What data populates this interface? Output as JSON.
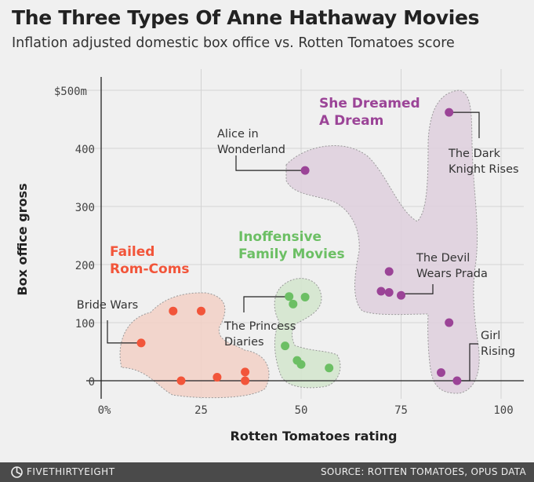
{
  "header": {
    "title": "The Three Types Of Anne Hathaway Movies",
    "subtitle": "Inflation adjusted domestic box office vs. Rotten Tomatoes score"
  },
  "footer": {
    "brand": "FIVETHIRTYEIGHT",
    "brand_icon": "fivethirtyeight-logo-icon",
    "source": "SOURCE: ROTTEN TOMATOES, OPUS DATA"
  },
  "chart_data": {
    "type": "scatter",
    "xlabel": "Rotten Tomatoes rating",
    "ylabel": "Box office gross",
    "xlim": [
      0,
      100
    ],
    "ylim": [
      0,
      500
    ],
    "x_ticks": [
      {
        "value": 0,
        "label": "0%"
      },
      {
        "value": 25,
        "label": "25"
      },
      {
        "value": 50,
        "label": "50"
      },
      {
        "value": 75,
        "label": "75"
      },
      {
        "value": 100,
        "label": "100"
      }
    ],
    "y_ticks": [
      {
        "value": 0,
        "label": "0"
      },
      {
        "value": 100,
        "label": "100"
      },
      {
        "value": 200,
        "label": "200"
      },
      {
        "value": 300,
        "label": "300"
      },
      {
        "value": 400,
        "label": "400"
      },
      {
        "value": 500,
        "label": "$500m"
      }
    ],
    "grid": true,
    "series": [
      {
        "name": "Failed Rom-Coms",
        "color": "#f2553a",
        "fill": "#f2d0c5",
        "points": [
          [
            10,
            65
          ],
          [
            18,
            120
          ],
          [
            25,
            120
          ],
          [
            20,
            0
          ],
          [
            29,
            6
          ],
          [
            36,
            15
          ],
          [
            36,
            0
          ]
        ]
      },
      {
        "name": "Inoffensive Family Movies",
        "color": "#6cbf64",
        "fill": "#d2e5cd",
        "points": [
          [
            47,
            145
          ],
          [
            48,
            132
          ],
          [
            51,
            144
          ],
          [
            46,
            60
          ],
          [
            49,
            35
          ],
          [
            50,
            28
          ],
          [
            57,
            22
          ]
        ]
      },
      {
        "name": "She Dreamed A Dream",
        "color": "#9b4497",
        "fill": "#decfdd",
        "points": [
          [
            51,
            362
          ],
          [
            72,
            188
          ],
          [
            70,
            154
          ],
          [
            72,
            152
          ],
          [
            75,
            147
          ],
          [
            87,
            462
          ],
          [
            87,
            100
          ],
          [
            85,
            14
          ],
          [
            89,
            0
          ]
        ]
      }
    ],
    "annotations": [
      {
        "text": "Bride Wars",
        "lines": [
          "Bride Wars"
        ]
      },
      {
        "text": "The Princess Diaries",
        "lines": [
          "The Princess",
          "Diaries"
        ]
      },
      {
        "text": "Alice in Wonderland",
        "lines": [
          "Alice in",
          "Wonderland"
        ]
      },
      {
        "text": "The Devil Wears Prada",
        "lines": [
          "The Devil",
          "Wears Prada"
        ]
      },
      {
        "text": "The Dark Knight Rises",
        "lines": [
          "The Dark",
          "Knight Rises"
        ]
      },
      {
        "text": "Girl Rising",
        "lines": [
          "Girl",
          "Rising"
        ]
      }
    ],
    "group_labels": [
      {
        "lines": [
          "Failed",
          "Rom-Coms"
        ],
        "color": "#f2553a"
      },
      {
        "lines": [
          "Inoffensive",
          "Family Movies"
        ],
        "color": "#6cbf64"
      },
      {
        "lines": [
          "She Dreamed",
          "A Dream"
        ],
        "color": "#9b4497"
      }
    ]
  }
}
